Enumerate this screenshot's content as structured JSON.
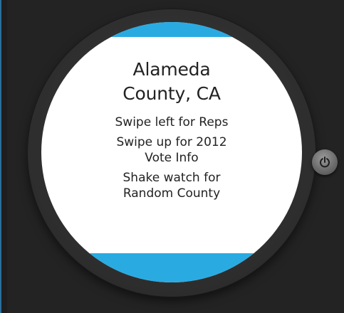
{
  "watch": {
    "title_line1": "Alameda",
    "title_line2": "County, CA",
    "instructions": [
      "Swipe left for Reps",
      "Swipe up for 2012",
      "Vote Info",
      "Shake watch for",
      "Random County"
    ]
  },
  "power_button": {
    "icon": "power-icon"
  },
  "colors": {
    "accent": "#29abe2",
    "background": "#232323",
    "screen": "#ffffff",
    "text": "#222222"
  }
}
